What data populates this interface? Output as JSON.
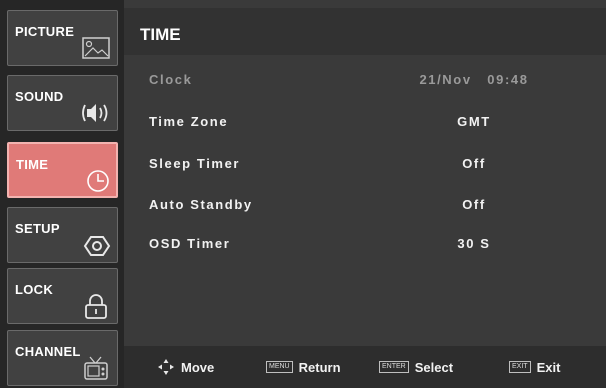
{
  "sidebar": {
    "items": [
      {
        "label": "PICTURE",
        "icon": "picture-icon",
        "active": false
      },
      {
        "label": "SOUND",
        "icon": "speaker-icon",
        "active": false
      },
      {
        "label": "TIME",
        "icon": "clock-icon",
        "active": true
      },
      {
        "label": "SETUP",
        "icon": "gear-icon",
        "active": false
      },
      {
        "label": "LOCK",
        "icon": "lock-icon",
        "active": false
      },
      {
        "label": "CHANNEL",
        "icon": "tv-icon",
        "active": false
      }
    ]
  },
  "main": {
    "title": "TIME",
    "rows": [
      {
        "label": "Clock",
        "value": "21/Nov   09:48",
        "disabled": true
      },
      {
        "label": "Time Zone",
        "value": "GMT",
        "disabled": false
      },
      {
        "label": "Sleep Timer",
        "value": "Off",
        "disabled": false
      },
      {
        "label": "Auto Standby",
        "value": "Off",
        "disabled": false
      },
      {
        "label": "OSD Timer",
        "value": "30 S",
        "disabled": false
      }
    ]
  },
  "footer": {
    "move": {
      "label": "Move",
      "icon": "move-arrows-icon"
    },
    "return": {
      "key": "MENU",
      "label": "Return"
    },
    "select": {
      "key": "ENTER",
      "label": "Select"
    },
    "exit": {
      "key": "EXIT",
      "label": "Exit"
    }
  },
  "colors": {
    "active_tab": "#e07a78",
    "background": "#3a3a3a",
    "sidebar": "#262626"
  }
}
